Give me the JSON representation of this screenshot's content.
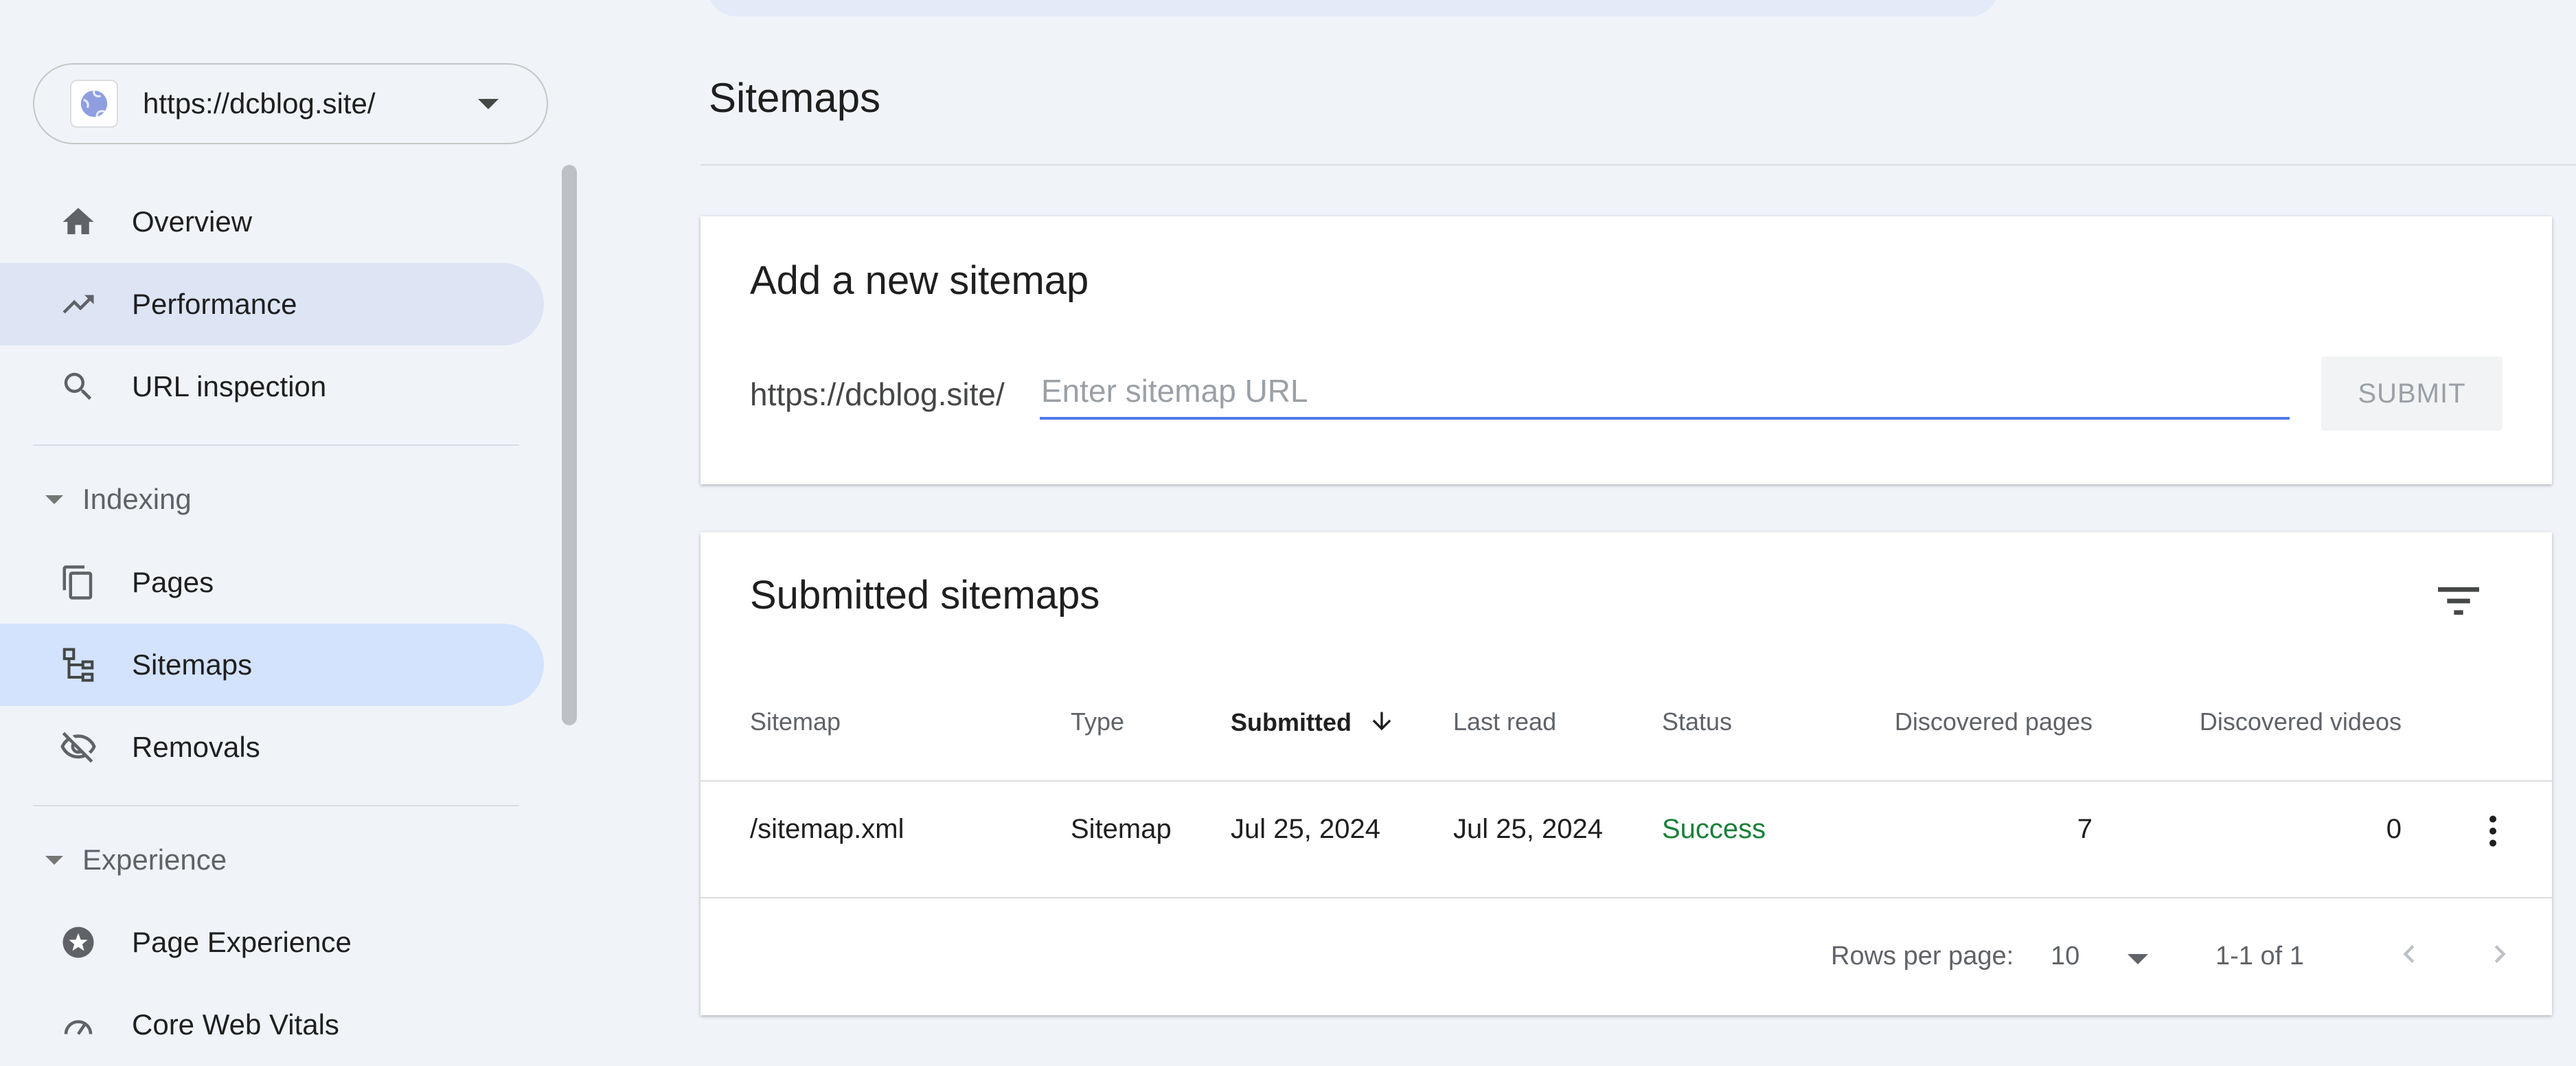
{
  "sidebar": {
    "property_url": "https://dcblog.site/",
    "items": [
      {
        "label": "Overview",
        "icon": "home-icon"
      },
      {
        "label": "Performance",
        "icon": "trending-up-icon"
      },
      {
        "label": "URL inspection",
        "icon": "search-icon"
      },
      {
        "label": "Pages",
        "icon": "pages-icon"
      },
      {
        "label": "Sitemaps",
        "icon": "sitemap-icon"
      },
      {
        "label": "Removals",
        "icon": "eye-off-icon"
      },
      {
        "label": "Page Experience",
        "icon": "page-experience-icon"
      },
      {
        "label": "Core Web Vitals",
        "icon": "speedometer-icon"
      }
    ],
    "sections": {
      "indexing": "Indexing",
      "experience": "Experience"
    }
  },
  "main": {
    "title": "Sitemaps",
    "add_card": {
      "title": "Add a new sitemap",
      "prefix": "https://dcblog.site/",
      "input_value": "",
      "input_placeholder": "Enter sitemap URL",
      "submit_label": "SUBMIT"
    },
    "list_card": {
      "title": "Submitted sitemaps",
      "columns": [
        "Sitemap",
        "Type",
        "Submitted",
        "Last read",
        "Status",
        "Discovered pages",
        "Discovered videos"
      ],
      "rows": [
        {
          "sitemap": "/sitemap.xml",
          "type": "Sitemap",
          "submitted": "Jul 25, 2024",
          "last_read": "Jul 25, 2024",
          "status": "Success",
          "pages": "7",
          "videos": "0"
        }
      ],
      "footer": {
        "rows_per_page_label": "Rows per page:",
        "rows_per_page_value": "10",
        "range": "1-1 of 1"
      }
    }
  },
  "colors": {
    "accent": "#4f7ae8",
    "active_nav": "#d3e3fd",
    "success": "#188038",
    "background": "#f0f4f9"
  }
}
